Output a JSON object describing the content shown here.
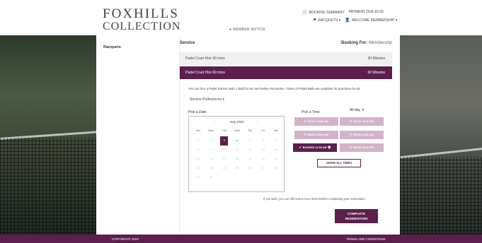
{
  "header": {
    "logo_line1": "FOXHILLS",
    "logo_line2": "COLLECTION",
    "member_notice": "MEMBER NOTICE",
    "booking_summary": "BOOKING SUMMARY",
    "payment_due": "PAYMENT DUE £0.00",
    "racquets": "RACQUETS",
    "welcome": "WELCOME MEMBERSHIP"
  },
  "sidebar": {
    "title": "Racquets"
  },
  "service": {
    "heading": "Service",
    "booking_for_label": "Booking For:",
    "booking_for_value": "Membership",
    "items": [
      {
        "name": "Padel Court Hire 30 mins",
        "duration": "30 Minutes"
      },
      {
        "name": "Padel Court Hire 60 mins",
        "duration": "60 Minutes"
      }
    ]
  },
  "info_text": "You can hire a Padel Racket (with 1 ball) for £5 via Pavilion Reception. Tubes of Padel Balls are available for purchase for £5",
  "preferences_label": "Service Preferences",
  "calendar": {
    "label": "Pick a Date",
    "prev": "‹",
    "month": "Sep 2024",
    "next": "›",
    "dows": [
      "Sun",
      "Mon",
      "Tue",
      "Wed",
      "Thu",
      "Fri",
      "Sat"
    ],
    "days": [
      "1",
      "2",
      "3",
      "4",
      "5",
      "6",
      "7",
      "8",
      "9",
      "10",
      "11",
      "12",
      "13",
      "14",
      "15",
      "16",
      "17",
      "18",
      "19",
      "20",
      "21",
      "22",
      "23",
      "24",
      "25",
      "26",
      "27",
      "28",
      "29",
      "30"
    ],
    "selected": "3",
    "available": [
      "4"
    ]
  },
  "time": {
    "label": "Pick a Time",
    "filter": "All day",
    "slots": [
      {
        "label": "BOOK 09:00 AM",
        "booked": false
      },
      {
        "label": "BOOK 09:30 AM",
        "booked": false
      },
      {
        "label": "BOOK 10:00 AM",
        "booked": false
      },
      {
        "label": "BOOK 10:30 AM",
        "booked": false
      },
      {
        "label": "BOOKED 11:00 AM",
        "booked": true
      },
      {
        "label": "BOOK 01:00 PM",
        "booked": false
      }
    ],
    "show_all": "SHOW ALL TIMES"
  },
  "wish_text": "If you wish, you can still select more times before completing your reservation",
  "complete_line1": "COMPLETE",
  "complete_line2": "RESERVATION",
  "footer": {
    "copyright": "COPYRIGHT 2024",
    "terms": "TERMS AND CONDITIONS"
  },
  "colors": {
    "brand": "#5c1f4d",
    "slot_light": "#d2b3c8"
  }
}
